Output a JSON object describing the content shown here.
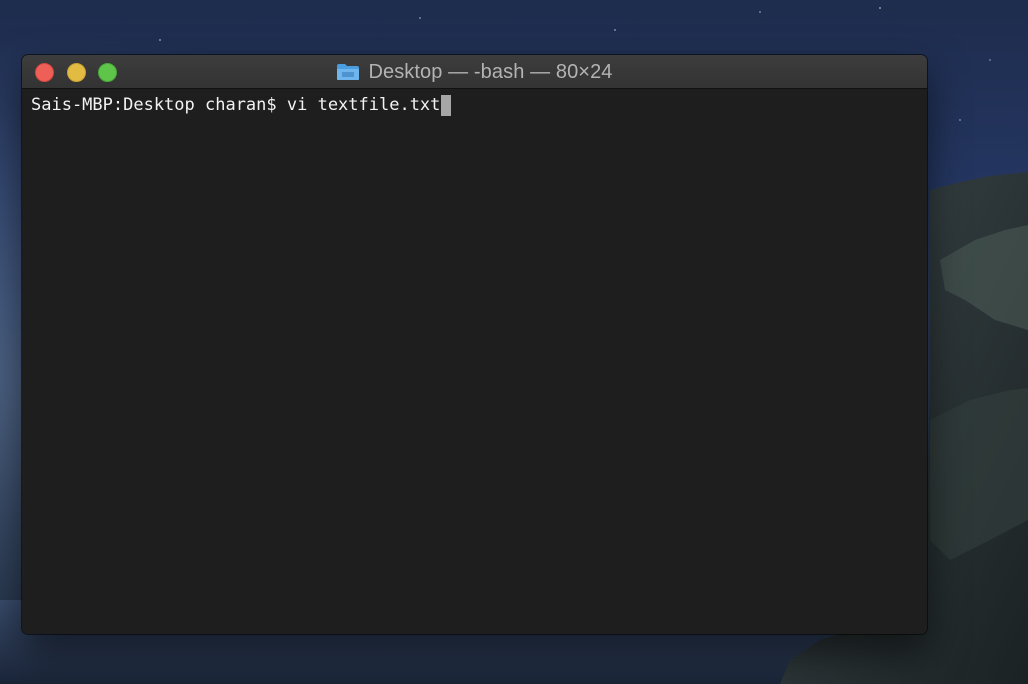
{
  "window": {
    "title": "Desktop — -bash — 80×24",
    "icon": "folder-icon",
    "buttons": {
      "close": "close-button",
      "minimize": "minimize-button",
      "zoom": "zoom-button"
    }
  },
  "terminal": {
    "prompt": "Sais-MBP:Desktop charan$ ",
    "command": "vi textfile.txt"
  },
  "colors": {
    "terminal_background": "#1e1e1e",
    "terminal_text": "#f2f2f2",
    "cursor": "#a6a6a6",
    "close": "#ed5f57",
    "minimize": "#e2bb43",
    "zoom": "#5ec54a"
  }
}
